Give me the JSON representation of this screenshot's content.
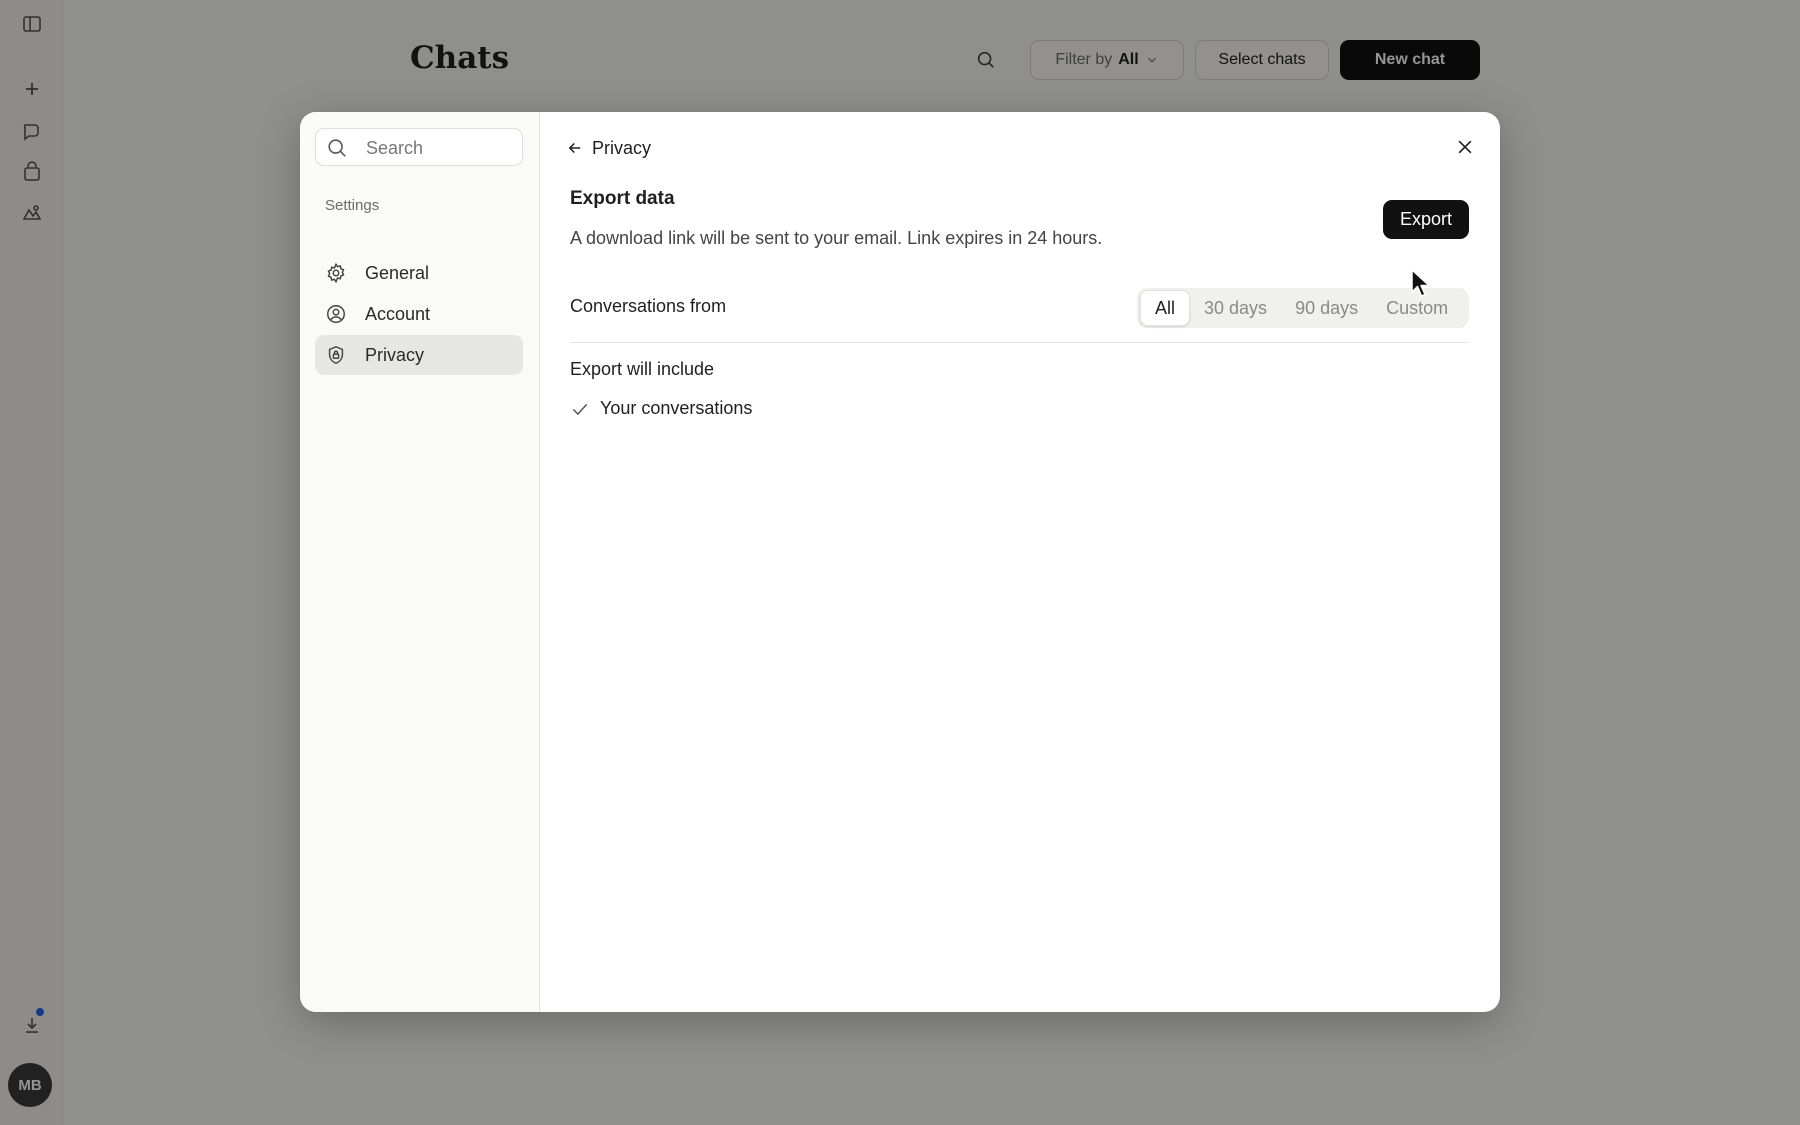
{
  "background": {
    "page_title": "Chats",
    "filter_prefix": "Filter by",
    "filter_value": "All",
    "select_chats_label": "Select chats",
    "new_chat_label": "New chat",
    "avatar_initials": "MB"
  },
  "modal": {
    "search_placeholder": "Search",
    "section_label": "Settings",
    "nav": [
      {
        "label": "General",
        "icon": "gear-icon"
      },
      {
        "label": "Account",
        "icon": "user-circle-icon"
      },
      {
        "label": "Privacy",
        "icon": "shield-lock-icon",
        "active": true
      }
    ],
    "back_label": "Privacy",
    "export_title": "Export data",
    "export_description": "A download link will be sent to your email. Link expires in 24 hours.",
    "export_button_label": "Export",
    "conversations_label": "Conversations from",
    "range_options": [
      "All",
      "30 days",
      "90 days",
      "Custom"
    ],
    "range_selected": "All",
    "include_title": "Export will include",
    "include_items": [
      "Your conversations"
    ]
  }
}
